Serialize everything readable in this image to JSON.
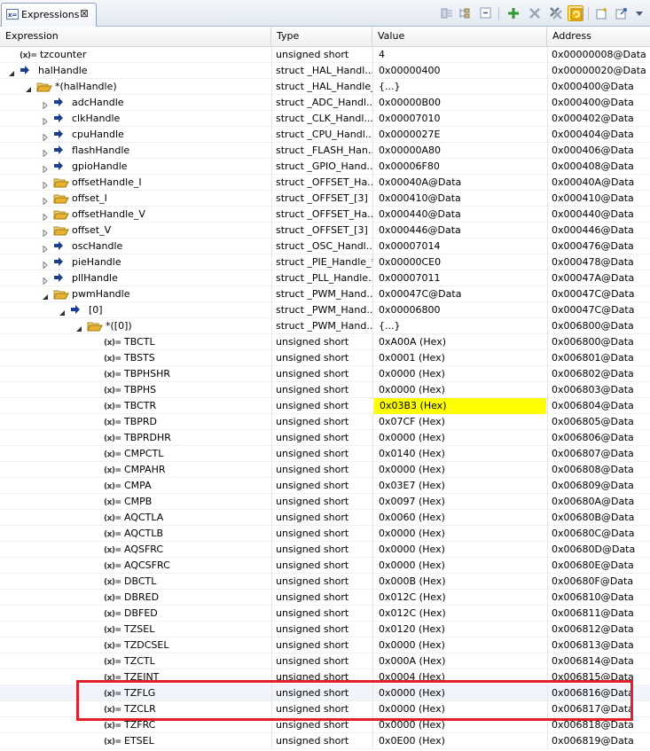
{
  "tab": {
    "label": "Expressions",
    "close": "⊠"
  },
  "columns": {
    "expression": "Expression",
    "type": "Type",
    "value": "Value",
    "address": "Address"
  },
  "rows": [
    {
      "name": "tzcounter",
      "type": "unsigned short",
      "value": "4",
      "address": "0x00000008@Data",
      "indent": 0,
      "expander": "none",
      "icon": "variable-icon"
    },
    {
      "name": "halHandle",
      "type": "struct _HAL_Handl...",
      "value": "0x00000400",
      "address": "0x00000020@Data",
      "indent": 0,
      "expander": "open",
      "icon": "pointer-icon"
    },
    {
      "name": "*(halHandle)",
      "type": "struct _HAL_Handle_",
      "value": "{...}",
      "address": "0x000400@Data",
      "indent": 1,
      "expander": "open",
      "icon": "struct-icon"
    },
    {
      "name": "adcHandle",
      "type": "struct _ADC_Handl...",
      "value": "0x00000B00",
      "address": "0x000400@Data",
      "indent": 2,
      "expander": "closed",
      "icon": "pointer-icon"
    },
    {
      "name": "clkHandle",
      "type": "struct _CLK_Handl...",
      "value": "0x00007010",
      "address": "0x000402@Data",
      "indent": 2,
      "expander": "closed",
      "icon": "pointer-icon"
    },
    {
      "name": "cpuHandle",
      "type": "struct _CPU_Handl...",
      "value": "0x0000027E",
      "address": "0x000404@Data",
      "indent": 2,
      "expander": "closed",
      "icon": "pointer-icon"
    },
    {
      "name": "flashHandle",
      "type": "struct _FLASH_Han...",
      "value": "0x00000A80",
      "address": "0x000406@Data",
      "indent": 2,
      "expander": "closed",
      "icon": "pointer-icon"
    },
    {
      "name": "gpioHandle",
      "type": "struct _GPIO_Hand...",
      "value": "0x00006F80",
      "address": "0x000408@Data",
      "indent": 2,
      "expander": "closed",
      "icon": "pointer-icon"
    },
    {
      "name": "offsetHandle_I",
      "type": "struct _OFFSET_Ha...",
      "value": "0x00040A@Data",
      "address": "0x00040A@Data",
      "indent": 2,
      "expander": "closed",
      "icon": "struct-icon"
    },
    {
      "name": "offset_I",
      "type": "struct _OFFSET_[3]",
      "value": "0x000410@Data",
      "address": "0x000410@Data",
      "indent": 2,
      "expander": "closed",
      "icon": "struct-icon"
    },
    {
      "name": "offsetHandle_V",
      "type": "struct _OFFSET_Ha...",
      "value": "0x000440@Data",
      "address": "0x000440@Data",
      "indent": 2,
      "expander": "closed",
      "icon": "struct-icon"
    },
    {
      "name": "offset_V",
      "type": "struct _OFFSET_[3]",
      "value": "0x000446@Data",
      "address": "0x000446@Data",
      "indent": 2,
      "expander": "closed",
      "icon": "struct-icon"
    },
    {
      "name": "oscHandle",
      "type": "struct _OSC_Handl...",
      "value": "0x00007014",
      "address": "0x000476@Data",
      "indent": 2,
      "expander": "closed",
      "icon": "pointer-icon"
    },
    {
      "name": "pieHandle",
      "type": "struct _PIE_Handle_*",
      "value": "0x00000CE0",
      "address": "0x000478@Data",
      "indent": 2,
      "expander": "closed",
      "icon": "pointer-icon"
    },
    {
      "name": "pllHandle",
      "type": "struct _PLL_Handle...",
      "value": "0x00007011",
      "address": "0x00047A@Data",
      "indent": 2,
      "expander": "closed",
      "icon": "pointer-icon"
    },
    {
      "name": "pwmHandle",
      "type": "struct _PWM_Hand...",
      "value": "0x00047C@Data",
      "address": "0x00047C@Data",
      "indent": 2,
      "expander": "open",
      "icon": "struct-icon"
    },
    {
      "name": "[0]",
      "type": "struct _PWM_Hand...",
      "value": "0x00006800",
      "address": "0x00047C@Data",
      "indent": 3,
      "expander": "open",
      "icon": "pointer-icon"
    },
    {
      "name": "*([0])",
      "type": "struct _PWM_Hand...",
      "value": "{...}",
      "address": "0x006800@Data",
      "indent": 4,
      "expander": "open",
      "icon": "struct-icon"
    },
    {
      "name": "TBCTL",
      "type": "unsigned short",
      "value": "0xA00A (Hex)",
      "address": "0x006800@Data",
      "indent": 5,
      "expander": "none",
      "icon": "variable-icon"
    },
    {
      "name": "TBSTS",
      "type": "unsigned short",
      "value": "0x0001 (Hex)",
      "address": "0x006801@Data",
      "indent": 5,
      "expander": "none",
      "icon": "variable-icon"
    },
    {
      "name": "TBPHSHR",
      "type": "unsigned short",
      "value": "0x0000 (Hex)",
      "address": "0x006802@Data",
      "indent": 5,
      "expander": "none",
      "icon": "variable-icon"
    },
    {
      "name": "TBPHS",
      "type": "unsigned short",
      "value": "0x0000 (Hex)",
      "address": "0x006803@Data",
      "indent": 5,
      "expander": "none",
      "icon": "variable-icon"
    },
    {
      "name": "TBCTR",
      "type": "unsigned short",
      "value": "0x03B3 (Hex)",
      "address": "0x006804@Data",
      "indent": 5,
      "expander": "none",
      "icon": "variable-icon",
      "changed": true
    },
    {
      "name": "TBPRD",
      "type": "unsigned short",
      "value": "0x07CF (Hex)",
      "address": "0x006805@Data",
      "indent": 5,
      "expander": "none",
      "icon": "variable-icon"
    },
    {
      "name": "TBPRDHR",
      "type": "unsigned short",
      "value": "0x0000 (Hex)",
      "address": "0x006806@Data",
      "indent": 5,
      "expander": "none",
      "icon": "variable-icon"
    },
    {
      "name": "CMPCTL",
      "type": "unsigned short",
      "value": "0x0140 (Hex)",
      "address": "0x006807@Data",
      "indent": 5,
      "expander": "none",
      "icon": "variable-icon"
    },
    {
      "name": "CMPAHR",
      "type": "unsigned short",
      "value": "0x0000 (Hex)",
      "address": "0x006808@Data",
      "indent": 5,
      "expander": "none",
      "icon": "variable-icon"
    },
    {
      "name": "CMPA",
      "type": "unsigned short",
      "value": "0x03E7 (Hex)",
      "address": "0x006809@Data",
      "indent": 5,
      "expander": "none",
      "icon": "variable-icon"
    },
    {
      "name": "CMPB",
      "type": "unsigned short",
      "value": "0x0097 (Hex)",
      "address": "0x00680A@Data",
      "indent": 5,
      "expander": "none",
      "icon": "variable-icon"
    },
    {
      "name": "AQCTLA",
      "type": "unsigned short",
      "value": "0x0060 (Hex)",
      "address": "0x00680B@Data",
      "indent": 5,
      "expander": "none",
      "icon": "variable-icon"
    },
    {
      "name": "AQCTLB",
      "type": "unsigned short",
      "value": "0x0000 (Hex)",
      "address": "0x00680C@Data",
      "indent": 5,
      "expander": "none",
      "icon": "variable-icon"
    },
    {
      "name": "AQSFRC",
      "type": "unsigned short",
      "value": "0x0000 (Hex)",
      "address": "0x00680D@Data",
      "indent": 5,
      "expander": "none",
      "icon": "variable-icon"
    },
    {
      "name": "AQCSFRC",
      "type": "unsigned short",
      "value": "0x0000 (Hex)",
      "address": "0x00680E@Data",
      "indent": 5,
      "expander": "none",
      "icon": "variable-icon"
    },
    {
      "name": "DBCTL",
      "type": "unsigned short",
      "value": "0x000B (Hex)",
      "address": "0x00680F@Data",
      "indent": 5,
      "expander": "none",
      "icon": "variable-icon"
    },
    {
      "name": "DBRED",
      "type": "unsigned short",
      "value": "0x012C (Hex)",
      "address": "0x006810@Data",
      "indent": 5,
      "expander": "none",
      "icon": "variable-icon"
    },
    {
      "name": "DBFED",
      "type": "unsigned short",
      "value": "0x012C (Hex)",
      "address": "0x006811@Data",
      "indent": 5,
      "expander": "none",
      "icon": "variable-icon"
    },
    {
      "name": "TZSEL",
      "type": "unsigned short",
      "value": "0x0120 (Hex)",
      "address": "0x006812@Data",
      "indent": 5,
      "expander": "none",
      "icon": "variable-icon"
    },
    {
      "name": "TZDCSEL",
      "type": "unsigned short",
      "value": "0x0000 (Hex)",
      "address": "0x006813@Data",
      "indent": 5,
      "expander": "none",
      "icon": "variable-icon"
    },
    {
      "name": "TZCTL",
      "type": "unsigned short",
      "value": "0x000A (Hex)",
      "address": "0x006814@Data",
      "indent": 5,
      "expander": "none",
      "icon": "variable-icon"
    },
    {
      "name": "TZEINT",
      "type": "unsigned short",
      "value": "0x0004 (Hex)",
      "address": "0x006815@Data",
      "indent": 5,
      "expander": "none",
      "icon": "variable-icon"
    },
    {
      "name": "TZFLG",
      "type": "unsigned short",
      "value": "0x0000 (Hex)",
      "address": "0x006816@Data",
      "indent": 5,
      "expander": "none",
      "icon": "variable-icon",
      "highlight": true
    },
    {
      "name": "TZCLR",
      "type": "unsigned short",
      "value": "0x0000 (Hex)",
      "address": "0x006817@Data",
      "indent": 5,
      "expander": "none",
      "icon": "variable-icon"
    },
    {
      "name": "TZFRC",
      "type": "unsigned short",
      "value": "0x0000 (Hex)",
      "address": "0x006818@Data",
      "indent": 5,
      "expander": "none",
      "icon": "variable-icon"
    },
    {
      "name": "ETSEL",
      "type": "unsigned short",
      "value": "0x0E00 (Hex)",
      "address": "0x006819@Data",
      "indent": 5,
      "expander": "none",
      "icon": "variable-icon"
    }
  ],
  "variable_glyph": "(x)=",
  "colors": {
    "changed_value_bg": "#ffff00",
    "annotation_box": "#e0202a",
    "pointer_arrow": "#1b3f8f",
    "folder": "#e8b230"
  }
}
